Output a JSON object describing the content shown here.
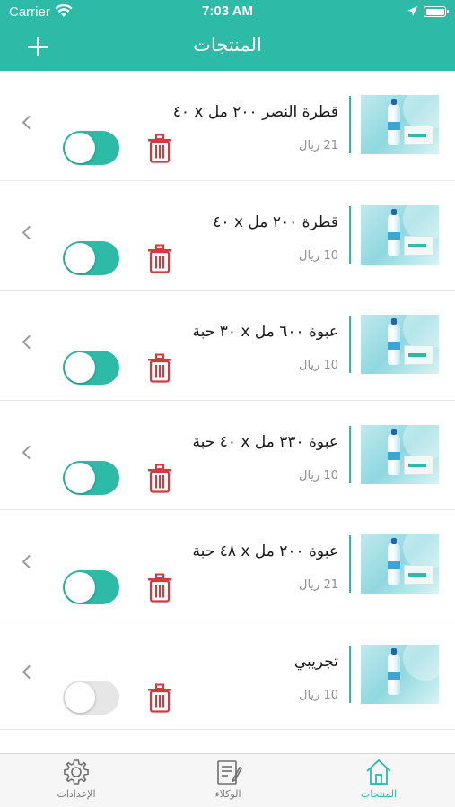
{
  "status_bar": {
    "carrier": "Carrier",
    "time": "7:03 AM"
  },
  "header": {
    "title": "المنتجات",
    "add_icon": "plus-icon"
  },
  "colors": {
    "accent": "#2dbaa7",
    "delete": "#d9363e",
    "toggle_off": "#e6e6e6"
  },
  "products": [
    {
      "name": "قطرة النصر ٢٠٠ مل x ٤٠",
      "price": "21 ريال",
      "enabled": true
    },
    {
      "name": "قطرة ٢٠٠ مل x ٤٠",
      "price": "10 ريال",
      "enabled": true
    },
    {
      "name": "عبوة ٦٠٠ مل x ٣٠ حبة",
      "price": "10 ريال",
      "enabled": true
    },
    {
      "name": "عبوة ٣٣٠ مل x ٤٠ حبة",
      "price": "10 ريال",
      "enabled": true
    },
    {
      "name": "عبوة ٢٠٠ مل x ٤٨ حبة",
      "price": "21 ريال",
      "enabled": true
    },
    {
      "name": "تجريبي",
      "price": "10 ريال",
      "enabled": false
    }
  ],
  "tabbar": {
    "settings": {
      "label": "الإعدادات",
      "icon": "gear-icon"
    },
    "agents": {
      "label": "الوكلاء",
      "icon": "notepad-icon"
    },
    "products": {
      "label": "المنتجات",
      "icon": "home-icon",
      "active": true
    }
  }
}
